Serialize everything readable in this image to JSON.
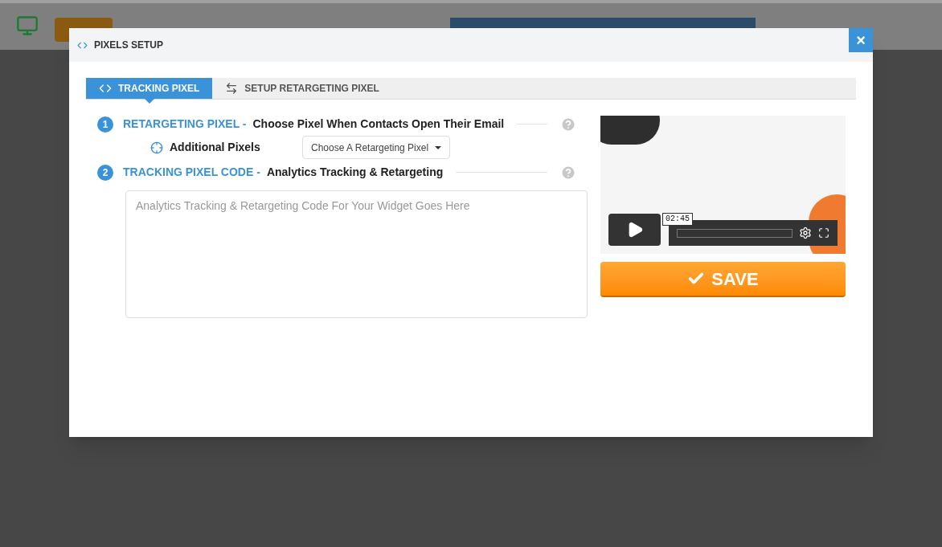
{
  "modal": {
    "title": "PIXELS SETUP",
    "close": "×"
  },
  "tabs": [
    {
      "label": "TRACKING PIXEL",
      "selected": true
    },
    {
      "label": "SETUP RETARGETING PIXEL",
      "selected": false
    }
  ],
  "sections": [
    {
      "number": "1",
      "heading": "RETARGETING PIXEL -",
      "subheading": "Choose Pixel When Contacts Open Their Email"
    },
    {
      "number": "2",
      "heading": "TRACKING PIXEL CODE -",
      "subheading": "Analytics Tracking & Retargeting"
    }
  ],
  "additional_pixels": {
    "label": "Additional Pixels",
    "dropdown": "Choose A Retargeting Pixel"
  },
  "code_field": {
    "placeholder": "Analytics Tracking & Retargeting Code For Your Widget Goes Here"
  },
  "video_player": {
    "time": "02:45"
  },
  "save_button": "SAVE"
}
